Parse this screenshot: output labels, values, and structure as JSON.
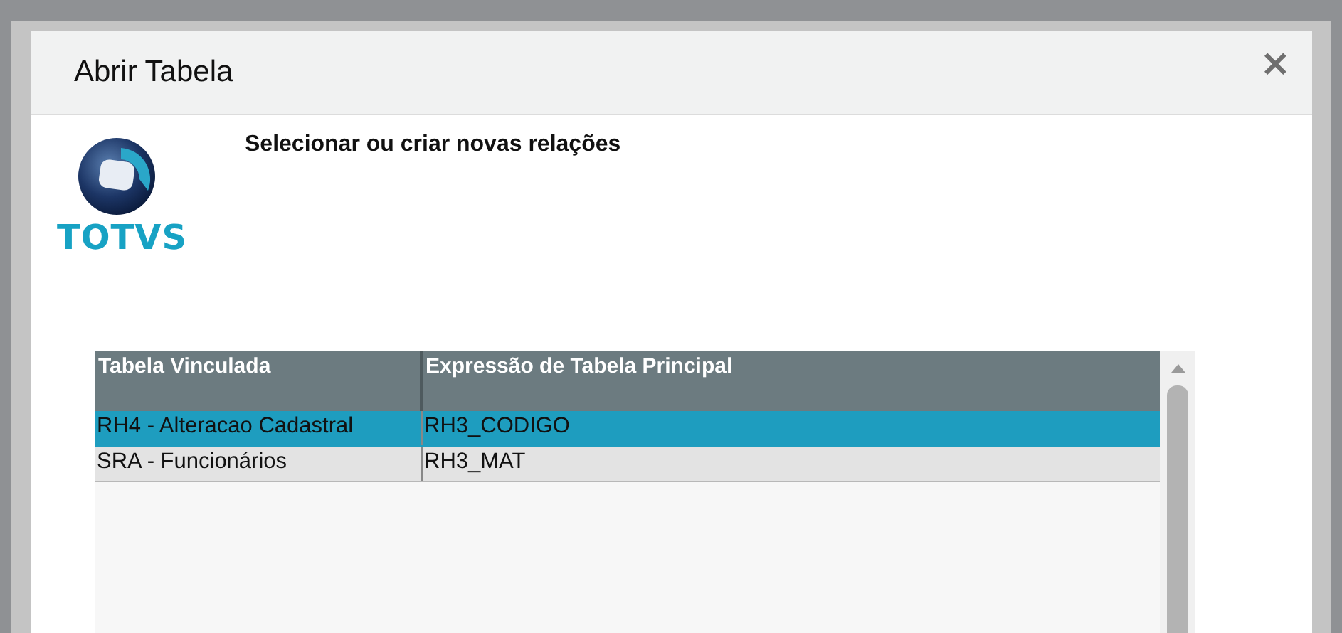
{
  "window": {
    "title": "Abrir Tabela",
    "close": "×"
  },
  "logo": {
    "text": "TOTVS"
  },
  "heading": "Selecionar ou criar novas relações",
  "table": {
    "columns": [
      "Tabela Vinculada",
      "Expressão de Tabela Principal"
    ],
    "rows": [
      {
        "cells": [
          "RH4 - Alteracao Cadastral",
          "RH3_CODIGO"
        ],
        "selected": true
      },
      {
        "cells": [
          "SRA - Funcionários",
          "RH3_MAT"
        ],
        "selected": false
      }
    ]
  }
}
